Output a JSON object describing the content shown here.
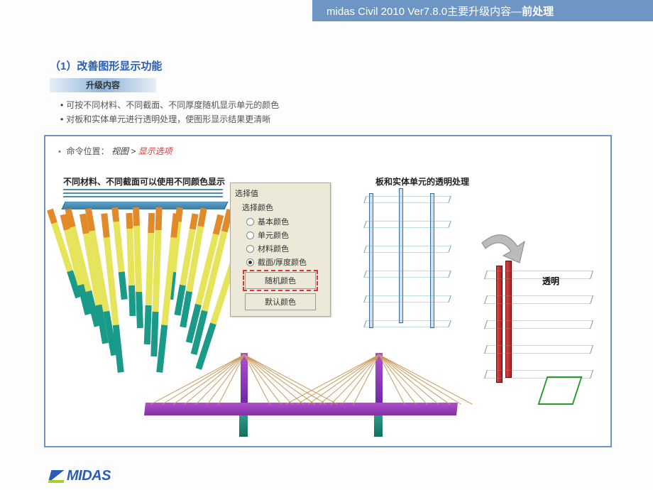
{
  "header": {
    "prefix": "midas Civil  2010 Ver7.8.0主要升级内容—",
    "bold": "前处理"
  },
  "section": {
    "title": "（1）改善图形显示功能",
    "badge": "升级内容"
  },
  "bullets": {
    "b1": "可按不同材料、不同截面、不同厚度随机显示单元的颜色",
    "b2": "对板和实体单元进行透明处理，使图形显示结果更清晰"
  },
  "command": {
    "prefix": "命令位置：",
    "menu": "视图 > ",
    "item": "显示选项"
  },
  "captions": {
    "left": "不同材料、不同截面可以使用不同颜色显示",
    "right": "板和实体单元的透明处理",
    "trans": "透明"
  },
  "dialog": {
    "group": "选择值",
    "sub": "选择颜色",
    "opt1": "基本颜色",
    "opt2": "单元颜色",
    "opt3": "材料颜色",
    "opt4": "截面/厚度颜色",
    "btn_random": "随机颜色",
    "btn_default": "默认颜色",
    "selected": "opt4"
  },
  "logo": {
    "text": "MIDAS"
  }
}
